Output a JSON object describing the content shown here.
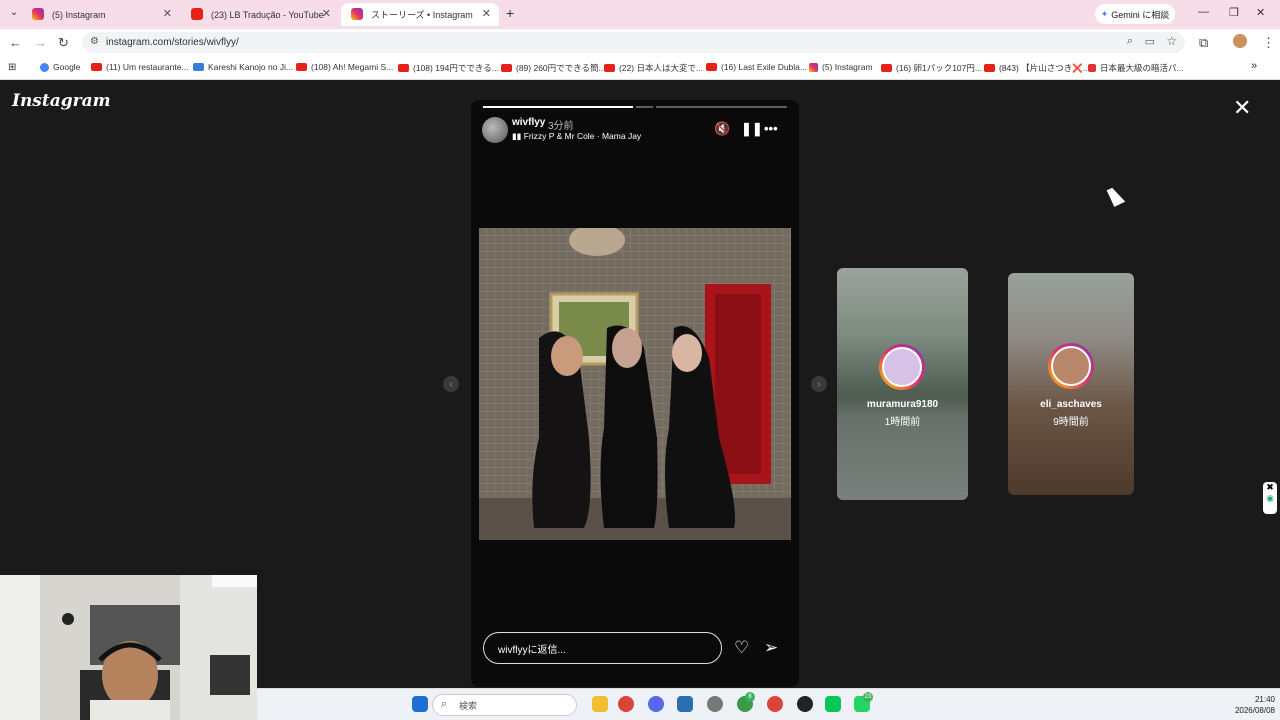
{
  "browser": {
    "tabs": [
      {
        "title": "(5) Instagram",
        "favicon": "instagram-icon",
        "active": false
      },
      {
        "title": "(23) LB Tradução - YouTube",
        "favicon": "youtube-icon",
        "active": false
      },
      {
        "title": "ストーリーズ • Instagram",
        "favicon": "instagram-icon",
        "active": true
      }
    ],
    "new_tab": "+",
    "gemini_label": "Gemini に相談",
    "url": "instagram.com/stories/wivflyy/",
    "bookmarks": [
      {
        "label": "Google",
        "color": "#4285f4"
      },
      {
        "label": "(11) Um restaurante...",
        "color": "#e62117"
      },
      {
        "label": "Kareshi Kanojo no Ji...",
        "color": "#3a7bd5"
      },
      {
        "label": "(108) Ah! Megami S...",
        "color": "#e62117"
      },
      {
        "label": "(108) 194円でできる...",
        "color": "#e62117"
      },
      {
        "label": "(89) 260円でできる簡...",
        "color": "#e62117"
      },
      {
        "label": "(22) 日本人は大変で...",
        "color": "#e62117"
      },
      {
        "label": "(16) Last Exile Dubla...",
        "color": "#e62117"
      },
      {
        "label": "(5) Instagram",
        "color": "#c13584"
      },
      {
        "label": "(16) 卵1パック107円...",
        "color": "#e62117"
      },
      {
        "label": "(843) 【片山さつき❌...",
        "color": "#e62117"
      },
      {
        "label": "日本最大級の暗活パ...",
        "color": "#d33"
      }
    ]
  },
  "instagram": {
    "logo": "Instagram",
    "story": {
      "username": "wivflyy",
      "time_ago": "3分前",
      "music": "Frizzy P & Mr Cole · Mama Jay",
      "progress_segments": [
        1.0,
        0.0,
        0.0
      ],
      "reply_placeholder": "wivflyyに返信..."
    },
    "next_stories": [
      {
        "username": "muramura9180",
        "time_ago": "1時間前"
      },
      {
        "username": "eli_aschaves",
        "time_ago": "9時間前"
      }
    ]
  },
  "taskbar": {
    "search_placeholder": "検索",
    "time": "21:40",
    "date": "2026/08/08",
    "badges": [
      "8",
      "23"
    ]
  }
}
